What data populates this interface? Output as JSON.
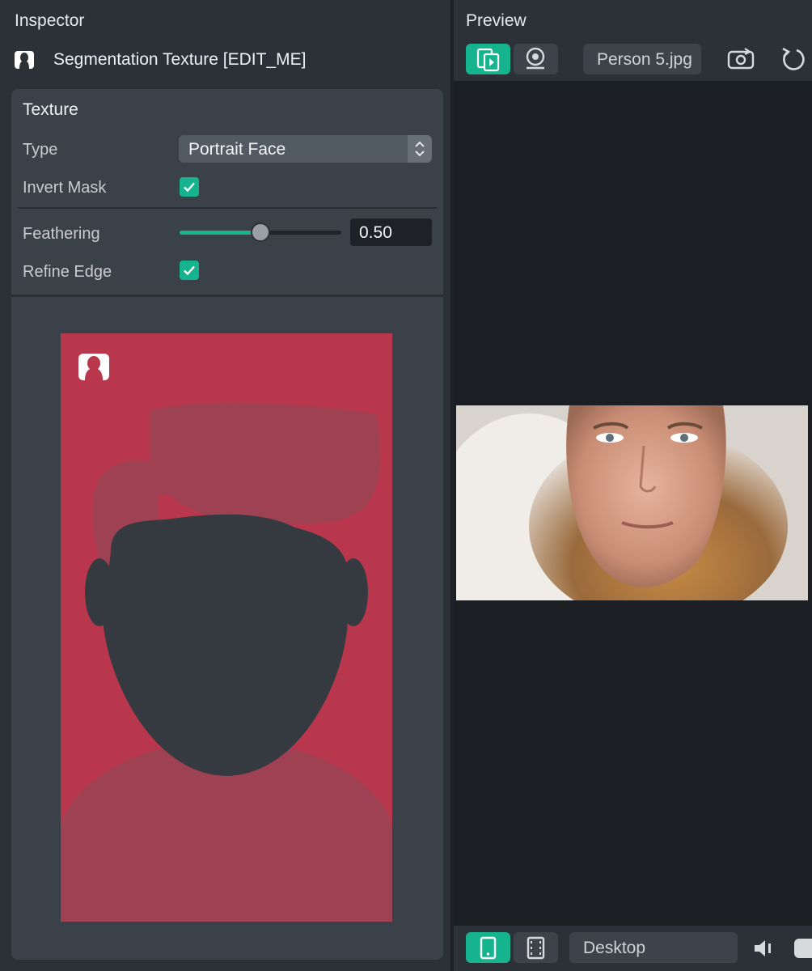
{
  "inspector": {
    "title": "Inspector",
    "asset_name": "Segmentation Texture [EDIT_ME]",
    "section_title": "Texture",
    "type_label": "Type",
    "type_value": "Portrait Face",
    "invert_mask_label": "Invert Mask",
    "invert_mask_checked": true,
    "feathering_label": "Feathering",
    "feathering_value": "0.50",
    "feathering_fraction": 0.5,
    "refine_edge_label": "Refine Edge",
    "refine_edge_checked": true
  },
  "preview": {
    "title": "Preview",
    "file_name": "Person 5.jpg",
    "device": "Desktop"
  },
  "colors": {
    "accent": "#15b48e",
    "mask_background": "#b9374c",
    "face_silhouette": "#353a41"
  },
  "icons": {
    "asset_icon": "segmentation-icon",
    "preview_mode": "photo-video-icon",
    "webcam": "webcam-icon",
    "swap_camera": "swap-camera-icon",
    "reset": "reset-icon",
    "mobile_view": "mobile-device-icon",
    "film_view": "film-strip-icon",
    "volume": "volume-icon"
  }
}
